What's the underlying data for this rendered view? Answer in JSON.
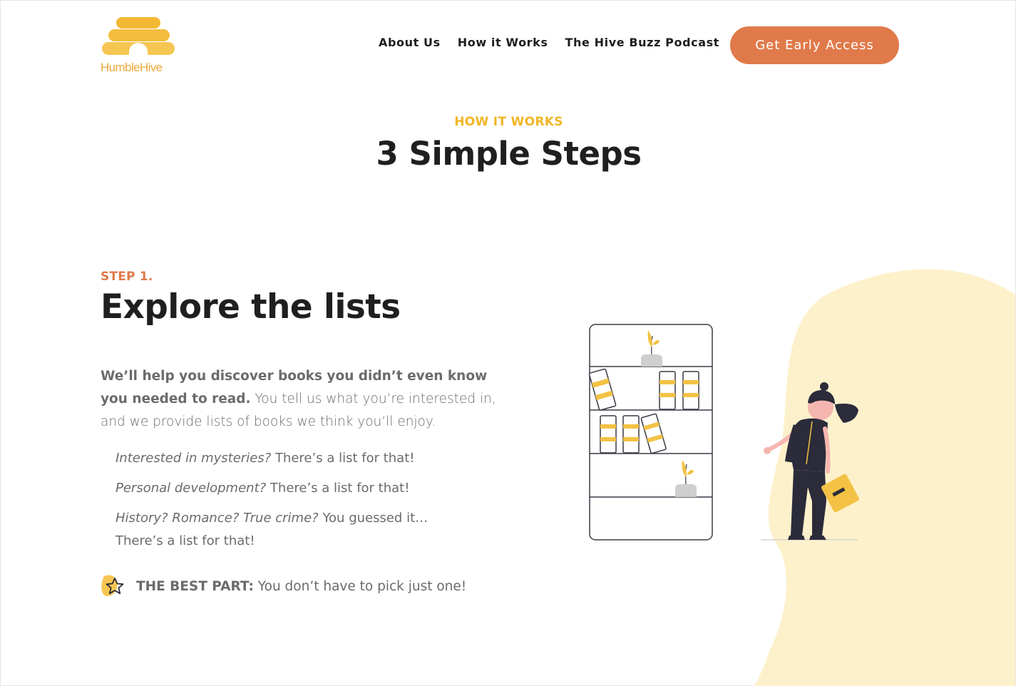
{
  "brand": {
    "name": "HumbleHive",
    "accent_orange": "#e07a4a",
    "accent_yellow": "#f1b525",
    "blob_color": "#fdf1cc"
  },
  "nav": {
    "items": [
      {
        "label": "About Us"
      },
      {
        "label": "How it Works"
      },
      {
        "label": "The Hive Buzz Podcast"
      }
    ],
    "cta_label": "Get Early Access"
  },
  "hero": {
    "eyebrow": "HOW IT WORKS",
    "title": "3 Simple Steps"
  },
  "step": {
    "label": "STEP 1.",
    "title": "Explore the lists",
    "intro_bold": "We’ll help you discover books you didn’t even know you needed to read.",
    "intro_rest": " You tell us what you’re interested in, and we provide lists of books we think you’ll enjoy.",
    "bullets": [
      {
        "italic": "Interested in mysteries?",
        "rest": " There’s a list for that!"
      },
      {
        "italic": "Personal development?",
        "rest": " There’s a list for that!"
      },
      {
        "italic": "History? Romance? True crime?",
        "rest": " You guessed it… There’s a list for that!"
      }
    ],
    "best_part_label": "THE BEST PART:",
    "best_part_text": " You don’t have to pick just one!",
    "best_part_icon": "star-icon"
  }
}
